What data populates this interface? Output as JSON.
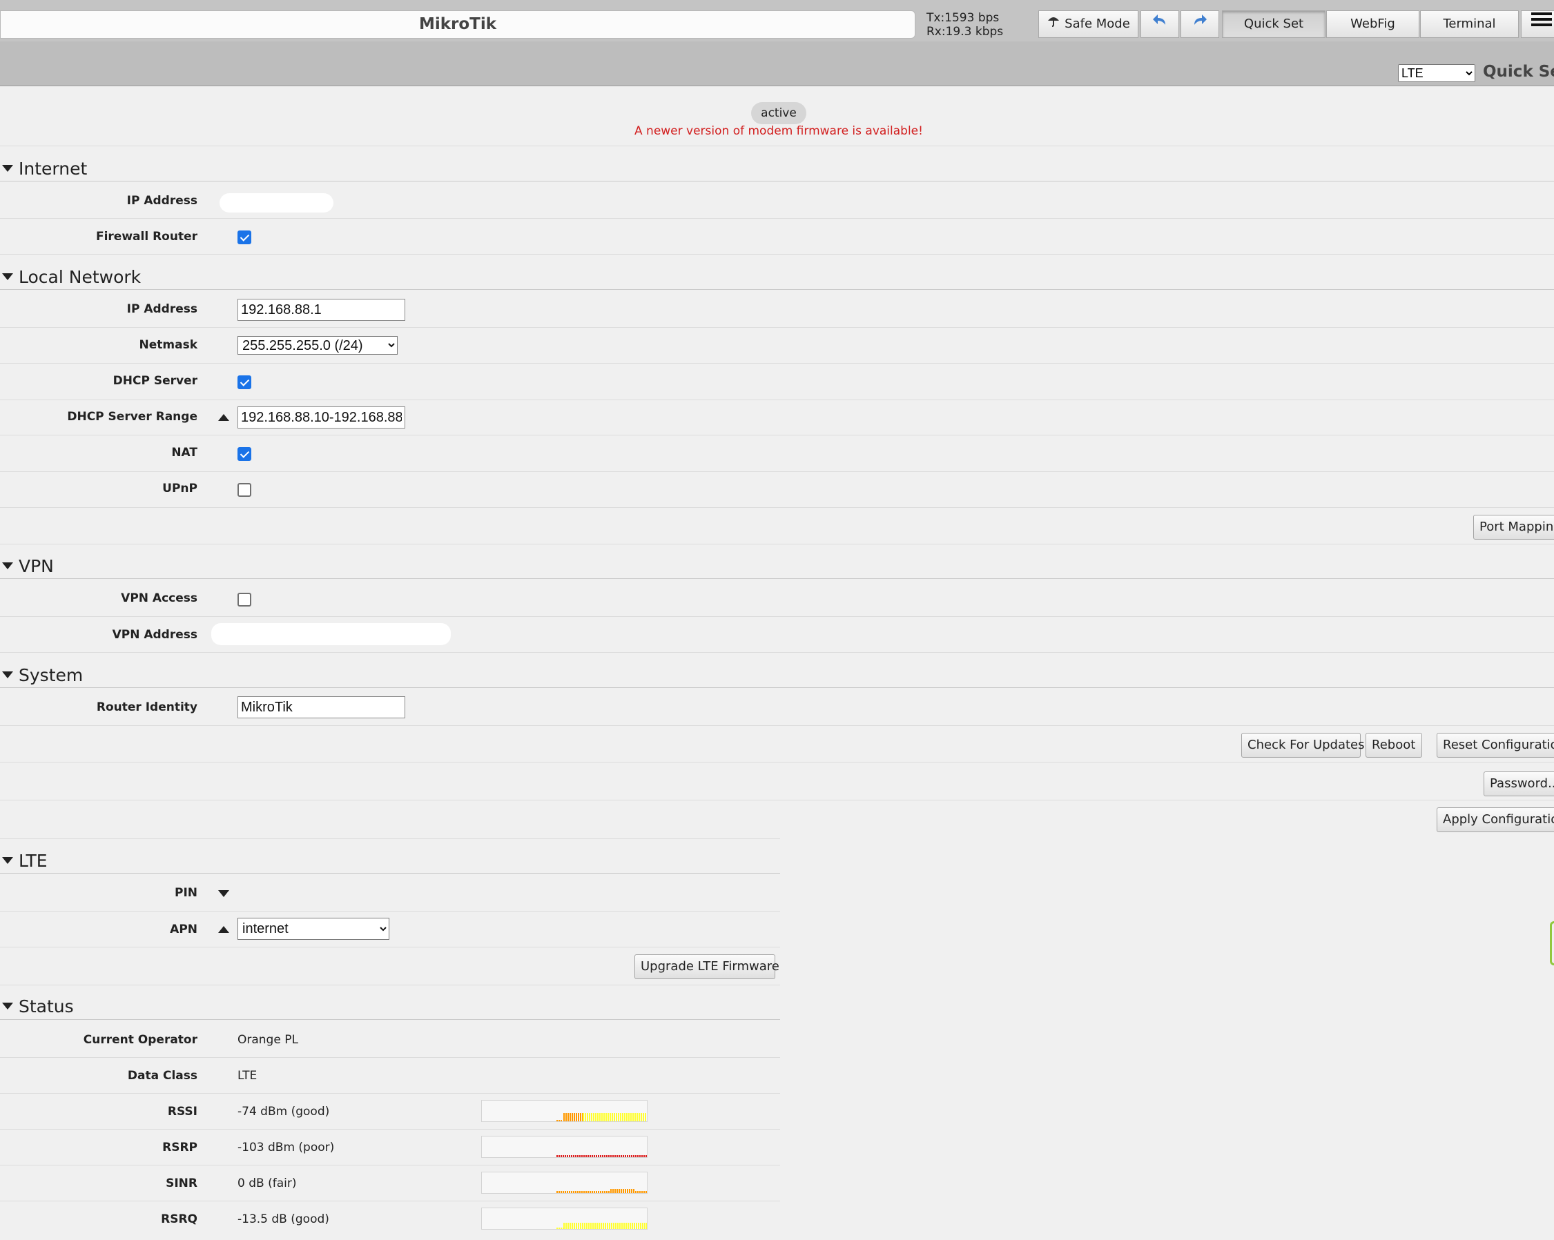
{
  "topbar": {
    "title": "MikroTik",
    "tx": "Tx:1593 bps",
    "rx": "Rx:19.3 kbps",
    "safe_mode_label": "Safe Mode",
    "tabs": [
      {
        "label": "Quick Set",
        "active": true
      },
      {
        "label": "WebFig",
        "active": false
      },
      {
        "label": "Terminal",
        "active": false
      }
    ]
  },
  "subbar": {
    "mode_selected": "LTE",
    "title": "Quick Se"
  },
  "header": {
    "status_pill": "active",
    "firmware_warning": "A newer version of modem firmware is available!"
  },
  "internet": {
    "title": "Internet",
    "ip_label": "IP Address",
    "firewall_label": "Firewall Router",
    "firewall_checked": true
  },
  "local_network": {
    "title": "Local Network",
    "ip_label": "IP Address",
    "ip_value": "192.168.88.1",
    "netmask_label": "Netmask",
    "netmask_value": "255.255.255.0 (/24)",
    "dhcp_label": "DHCP Server",
    "dhcp_checked": true,
    "range_label": "DHCP Server Range",
    "range_value": "192.168.88.10-192.168.88",
    "nat_label": "NAT",
    "nat_checked": true,
    "upnp_label": "UPnP",
    "upnp_checked": false,
    "port_mapping_label": "Port Mapping"
  },
  "vpn": {
    "title": "VPN",
    "access_label": "VPN Access",
    "access_checked": false,
    "address_label": "VPN Address"
  },
  "system": {
    "title": "System",
    "identity_label": "Router Identity",
    "identity_value": "MikroTik",
    "check_updates_label": "Check For Updates",
    "reboot_label": "Reboot",
    "reset_label": "Reset Configuration",
    "password_label": "Password...",
    "apply_label": "Apply Configuration"
  },
  "lte": {
    "title": "LTE",
    "pin_label": "PIN",
    "apn_label": "APN",
    "apn_value": "internet",
    "upgrade_label": "Upgrade LTE Firmware"
  },
  "status": {
    "title": "Status",
    "operator_label": "Current Operator",
    "operator_value": "Orange PL",
    "data_class_label": "Data Class",
    "data_class_value": "LTE",
    "rssi_label": "RSSI",
    "rssi_value": "-74 dBm (good)",
    "rsrp_label": "RSRP",
    "rsrp_value": "-103 dBm (poor)",
    "sinr_label": "SINR",
    "sinr_value": "0 dB (fair)",
    "rsrq_label": "RSRQ",
    "rsrq_value": "-13.5 dB (good)"
  },
  "colors": {
    "good": "#ffff33",
    "fair": "#ff9900",
    "poor": "#dd2222",
    "warning": "#d21f1f",
    "checkbox": "#1a73e8"
  }
}
